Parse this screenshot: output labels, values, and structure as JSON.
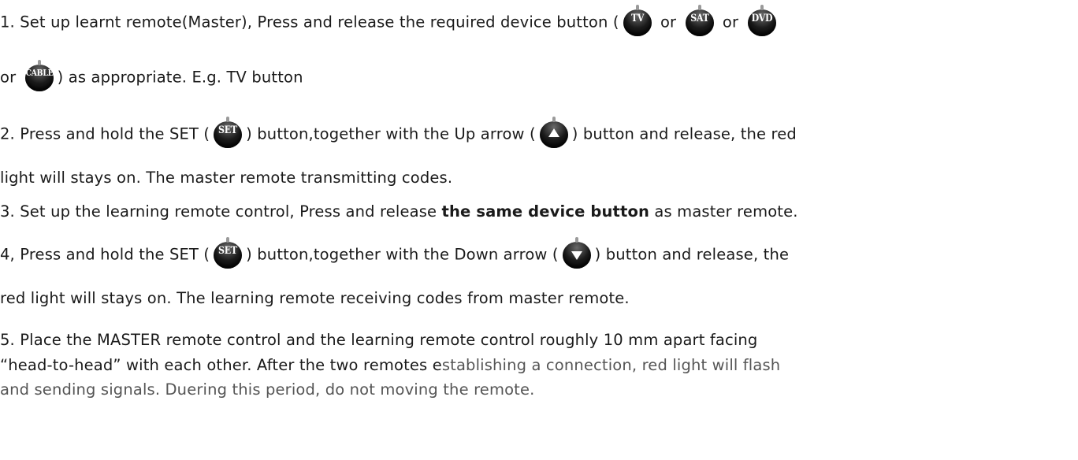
{
  "steps": {
    "s1": {
      "part1": "1. Set up learnt remote(Master), Press and release the required device button (",
      "or1": " or ",
      "or2": " or ",
      "or3": "or ",
      "part2": ") as appropriate. E.g. TV button"
    },
    "s2": {
      "part1": "2. Press and hold the SET (",
      "part2": ") button,together with the Up arrow (",
      "part3": ") button and release, the red",
      "line2": "light will stays on. The master remote transmitting codes."
    },
    "s3": {
      "part1": "3. Set up the learning remote control, Press and release ",
      "bold": "the same device button",
      "part2": " as master remote."
    },
    "s4": {
      "part1": "4, Press and hold the SET (",
      "part2": ") button,together with the Down arrow (",
      "part3": ") button and release, the",
      "line2": "red light will stays on. The learning remote receiving codes from master remote."
    },
    "s5": {
      "line1": "5. Place the MASTER remote control and the learning remote control roughly 10 mm apart facing",
      "line2a": "“head-to-head” with each other. After the two remotes e",
      "line2b": "stablishing a connection, red light will flash",
      "line3": "and sending signals. Duering this period, do not moving the remote."
    }
  },
  "buttons": {
    "tv": "TV",
    "sat": "SAT",
    "dvd": "DVD",
    "cable": "CABLE",
    "set": "SET",
    "up_icon": "up-arrow-icon",
    "down_icon": "down-arrow-icon"
  }
}
